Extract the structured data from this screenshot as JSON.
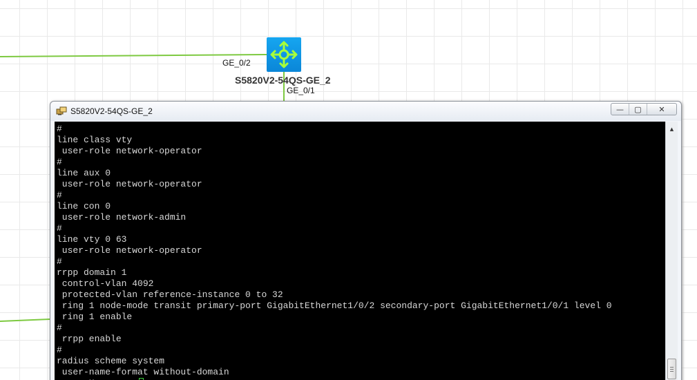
{
  "topology": {
    "device_name": "S5820V2-54QS-GE_2",
    "port_left": "GE_0/2",
    "port_bottom": "GE_0/1",
    "link_color": "#7dc940",
    "device_icon": "layer3-switch-icon"
  },
  "console": {
    "title": "S5820V2-54QS-GE_2",
    "minimize_glyph": "—",
    "maximize_glyph": "▢",
    "close_glyph": "✕",
    "lines": [
      "#",
      "line class vty",
      " user-role network-operator",
      "#",
      "line aux 0",
      " user-role network-operator",
      "#",
      "line con 0",
      " user-role network-admin",
      "#",
      "line vty 0 63",
      " user-role network-operator",
      "#",
      "rrpp domain 1",
      " control-vlan 4092",
      " protected-vlan reference-instance 0 to 32",
      " ring 1 node-mode transit primary-port GigabitEthernet1/0/2 secondary-port GigabitEthernet1/0/1 level 0",
      " ring 1 enable",
      "#",
      " rrpp enable",
      "#",
      "radius scheme system",
      " user-name-format without-domain"
    ],
    "prompt_partial": " ---- More ----"
  },
  "colors": {
    "terminal_bg": "#000000",
    "terminal_text": "#d8d8d8",
    "accent_blue": "#0a95e6",
    "cursor_green": "#3cd03c"
  }
}
